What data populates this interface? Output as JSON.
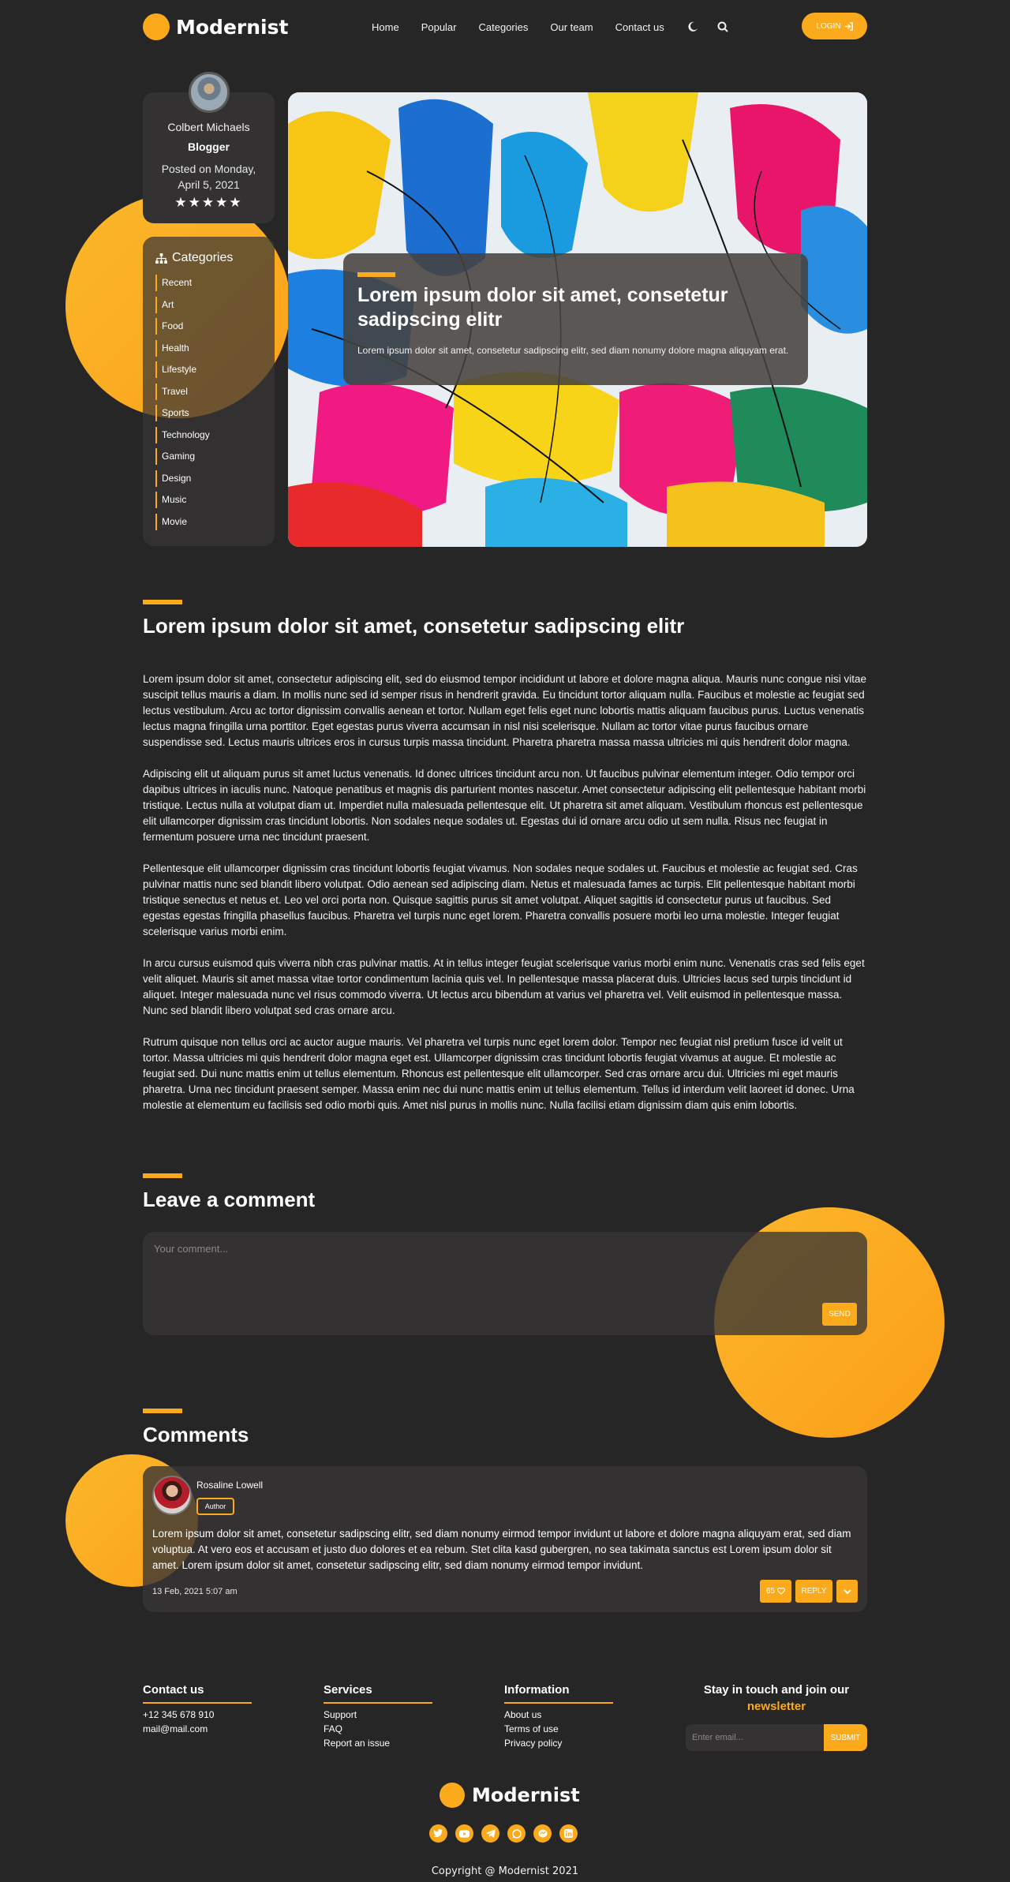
{
  "brand": {
    "name": "Modernist",
    "accent": "#fbaa1c",
    "background": "#262626"
  },
  "nav": {
    "items": [
      "Home",
      "Popular",
      "Categories",
      "Our team",
      "Contact us"
    ],
    "theme_icon": "moon-icon",
    "search_icon": "search-icon",
    "login_label": "LOGIN"
  },
  "profile": {
    "name": "Colbert Michaels",
    "role": "Blogger",
    "posted": "Posted on Monday, April 5, 2021",
    "rating": 5,
    "stars": "★★★★★"
  },
  "categories": {
    "title": "Categories",
    "items": [
      "Recent",
      "Art",
      "Food",
      "Health",
      "Lifestyle",
      "Travel",
      "Sports",
      "Technology",
      "Gaming",
      "Design",
      "Music",
      "Movie"
    ]
  },
  "hero": {
    "title": "Lorem ipsum dolor sit amet, consetetur sadipscing elitr",
    "subtitle": "Lorem ipsum dolor sit amet, consetetur sadipscing elitr, sed diam nonumy dolore magna aliquyam erat."
  },
  "article": {
    "title": "Lorem ipsum dolor sit amet, consetetur sadipscing elitr",
    "paragraphs": [
      "Lorem ipsum dolor sit amet, consectetur adipiscing elit, sed do eiusmod tempor incididunt ut labore et dolore magna aliqua. Mauris nunc congue nisi vitae suscipit tellus mauris a diam. In mollis nunc sed id semper risus in hendrerit gravida. Eu tincidunt tortor aliquam nulla. Faucibus et molestie ac feugiat sed lectus vestibulum. Arcu ac tortor dignissim convallis aenean et tortor. Nullam eget felis eget nunc lobortis mattis aliquam faucibus purus. Luctus venenatis lectus magna fringilla urna porttitor. Eget egestas purus viverra accumsan in nisl nisi scelerisque. Nullam ac tortor vitae purus faucibus ornare suspendisse sed. Lectus mauris ultrices eros in cursus turpis massa tincidunt. Pharetra pharetra massa massa ultricies mi quis hendrerit dolor magna.",
      "Adipiscing elit ut aliquam purus sit amet luctus venenatis. Id donec ultrices tincidunt arcu non. Ut faucibus pulvinar elementum integer. Odio tempor orci dapibus ultrices in iaculis nunc. Natoque penatibus et magnis dis parturient montes nascetur. Amet consectetur adipiscing elit pellentesque habitant morbi tristique. Lectus nulla at volutpat diam ut. Imperdiet nulla malesuada pellentesque elit. Ut pharetra sit amet aliquam. Vestibulum rhoncus est pellentesque elit ullamcorper dignissim cras tincidunt lobortis. Non sodales neque sodales ut. Egestas dui id ornare arcu odio ut sem nulla. Risus nec feugiat in fermentum posuere urna nec tincidunt praesent.",
      "Pellentesque elit ullamcorper dignissim cras tincidunt lobortis feugiat vivamus. Non sodales neque sodales ut. Faucibus et molestie ac feugiat sed. Cras pulvinar mattis nunc sed blandit libero volutpat. Odio aenean sed adipiscing diam. Netus et malesuada fames ac turpis. Elit pellentesque habitant morbi tristique senectus et netus et. Leo vel orci porta non. Quisque sagittis purus sit amet volutpat. Aliquet sagittis id consectetur purus ut faucibus. Sed egestas egestas fringilla phasellus faucibus. Pharetra vel turpis nunc eget lorem. Pharetra convallis posuere morbi leo urna molestie. Integer feugiat scelerisque varius morbi enim.",
      "In arcu cursus euismod quis viverra nibh cras pulvinar mattis. At in tellus integer feugiat scelerisque varius morbi enim nunc. Venenatis cras sed felis eget velit aliquet. Mauris sit amet massa vitae tortor condimentum lacinia quis vel. In pellentesque massa placerat duis. Ultricies lacus sed turpis tincidunt id aliquet. Integer malesuada nunc vel risus commodo viverra. Ut lectus arcu bibendum at varius vel pharetra vel. Velit euismod in pellentesque massa. Nunc sed blandit libero volutpat sed cras ornare arcu.",
      "Rutrum quisque non tellus orci ac auctor augue mauris. Vel pharetra vel turpis nunc eget lorem dolor. Tempor nec feugiat nisl pretium fusce id velit ut tortor. Massa ultricies mi quis hendrerit dolor magna eget est. Ullamcorper dignissim cras tincidunt lobortis feugiat vivamus at augue. Et molestie ac feugiat sed. Dui nunc mattis enim ut tellus elementum. Rhoncus est pellentesque elit ullamcorper. Sed cras ornare arcu dui. Ultricies mi eget mauris pharetra. Urna nec tincidunt praesent semper. Massa enim nec dui nunc mattis enim ut tellus elementum. Tellus id interdum velit laoreet id donec. Urna molestie at elementum eu facilisis sed odio morbi quis. Amet nisl purus in mollis nunc. Nulla facilisi etiam dignissim diam quis enim lobortis."
    ]
  },
  "comment_form": {
    "title": "Leave a comment",
    "placeholder": "Your comment...",
    "value": "",
    "send_label": "SEND"
  },
  "comments": {
    "title": "Comments",
    "items": [
      {
        "author": "Rosaline Lowell",
        "badge": "Author",
        "text": "Lorem ipsum dolor sit amet, consetetur sadipscing elitr, sed diam nonumy eirmod tempor invidunt ut labore et dolore magna aliquyam erat, sed diam voluptua. At vero eos et accusam et justo duo dolores et ea rebum. Stet clita kasd gubergren, no sea takimata sanctus est Lorem ipsum dolor sit amet. Lorem ipsum dolor sit amet, consetetur sadipscing elitr, sed diam nonumy eirmod tempor invidunt.",
        "date": "13 Feb, 2021 5:07 am",
        "likes": "65",
        "reply_label": "REPLY"
      }
    ]
  },
  "footer": {
    "contact": {
      "title": "Contact us",
      "items": [
        "+12 345 678 910",
        "mail@mail.com"
      ]
    },
    "services": {
      "title": "Services",
      "items": [
        "Support",
        "FAQ",
        "Report an issue"
      ]
    },
    "information": {
      "title": "Information",
      "items": [
        "About us",
        "Terms of use",
        "Privacy policy"
      ]
    },
    "newsletter": {
      "line1": "Stay in touch and join our",
      "line2": "newsletter",
      "placeholder": "Enter email...",
      "submit_label": "SUBMIT"
    },
    "social_icons": [
      "twitter-icon",
      "youtube-icon",
      "telegram-icon",
      "whatsapp-icon",
      "messenger-icon",
      "linkedin-icon"
    ],
    "copyright": "Copyright @ Modernist 2021"
  }
}
